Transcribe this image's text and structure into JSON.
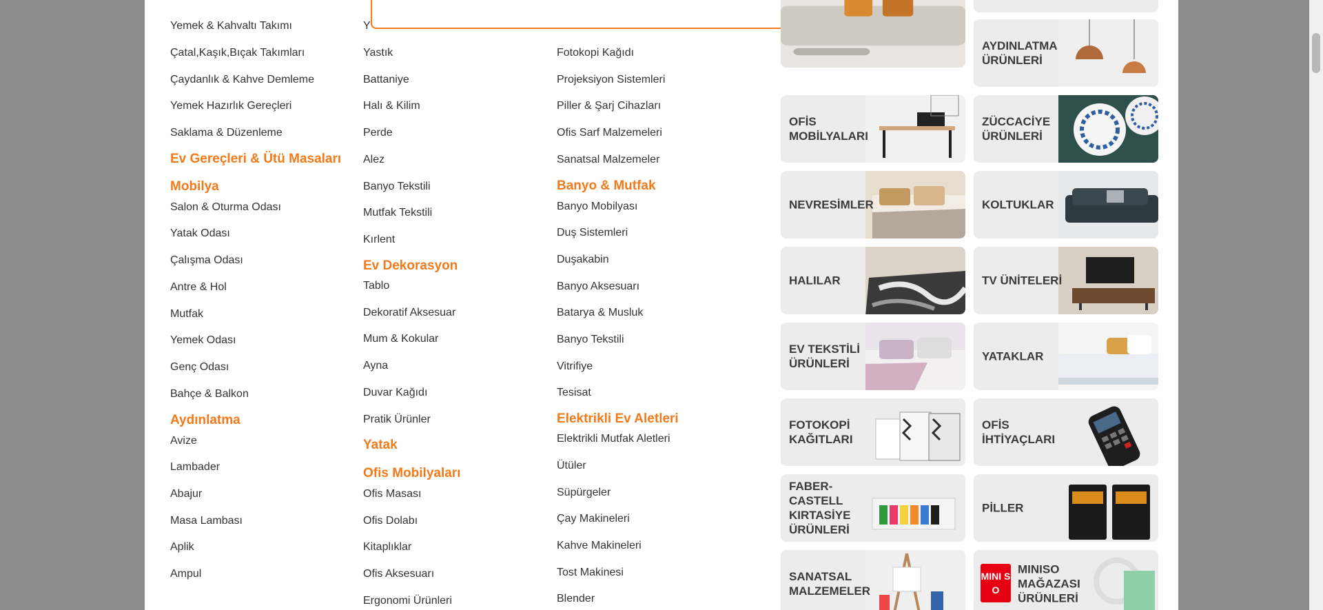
{
  "search_popup": {},
  "columns": [
    {
      "entries": [
        {
          "type": "item",
          "label": "Yemek & Kahvaltı Takımı"
        },
        {
          "type": "item",
          "label": "Çatal,Kaşık,Bıçak Takımları"
        },
        {
          "type": "item",
          "label": "Çaydanlık & Kahve Demleme"
        },
        {
          "type": "item",
          "label": "Yemek Hazırlık Gereçleri"
        },
        {
          "type": "item",
          "label": "Saklama & Düzenleme"
        },
        {
          "type": "head",
          "label": "Ev Gereçleri & Ütü Masaları"
        },
        {
          "type": "head",
          "label": "Mobilya"
        },
        {
          "type": "item",
          "label": "Salon & Oturma Odası"
        },
        {
          "type": "item",
          "label": "Yatak Odası"
        },
        {
          "type": "item",
          "label": "Çalışma Odası"
        },
        {
          "type": "item",
          "label": "Antre & Hol"
        },
        {
          "type": "item",
          "label": "Mutfak"
        },
        {
          "type": "item",
          "label": "Yemek Odası"
        },
        {
          "type": "item",
          "label": "Genç Odası"
        },
        {
          "type": "item",
          "label": "Bahçe & Balkon"
        },
        {
          "type": "head",
          "label": "Aydınlatma"
        },
        {
          "type": "item",
          "label": "Avize"
        },
        {
          "type": "item",
          "label": "Lambader"
        },
        {
          "type": "item",
          "label": "Abajur"
        },
        {
          "type": "item",
          "label": "Masa Lambası"
        },
        {
          "type": "item",
          "label": "Aplik"
        },
        {
          "type": "item",
          "label": "Ampul"
        }
      ]
    },
    {
      "entries": [
        {
          "type": "item",
          "label": "Y"
        },
        {
          "type": "item",
          "label": "Yastık"
        },
        {
          "type": "item",
          "label": "Battaniye"
        },
        {
          "type": "item",
          "label": "Halı & Kilim"
        },
        {
          "type": "item",
          "label": "Perde"
        },
        {
          "type": "item",
          "label": "Alez"
        },
        {
          "type": "item",
          "label": "Banyo Tekstili"
        },
        {
          "type": "item",
          "label": "Mutfak Tekstili"
        },
        {
          "type": "item",
          "label": "Kırlent"
        },
        {
          "type": "head",
          "label": "Ev Dekorasyon"
        },
        {
          "type": "item",
          "label": "Tablo"
        },
        {
          "type": "item",
          "label": "Dekoratif Aksesuar"
        },
        {
          "type": "item",
          "label": "Mum & Kokular"
        },
        {
          "type": "item",
          "label": "Ayna"
        },
        {
          "type": "item",
          "label": "Duvar Kağıdı"
        },
        {
          "type": "item",
          "label": "Pratik Ürünler"
        },
        {
          "type": "head",
          "label": "Yatak"
        },
        {
          "type": "head",
          "label": "Ofis Mobilyaları"
        },
        {
          "type": "item",
          "label": "Ofis Masası"
        },
        {
          "type": "item",
          "label": "Ofis Dolabı"
        },
        {
          "type": "item",
          "label": "Kitaplıklar"
        },
        {
          "type": "item",
          "label": "Ofis Aksesuarı"
        },
        {
          "type": "item",
          "label": "Ergonomi Ürünleri"
        }
      ]
    },
    {
      "entries": [
        {
          "type": "item",
          "label": "Fotokopi Kağıdı"
        },
        {
          "type": "item",
          "label": "Projeksiyon Sistemleri"
        },
        {
          "type": "item",
          "label": "Piller & Şarj Cihazları"
        },
        {
          "type": "item",
          "label": "Ofis Sarf Malzemeleri"
        },
        {
          "type": "item",
          "label": "Sanatsal Malzemeler"
        },
        {
          "type": "head",
          "label": "Banyo & Mutfak"
        },
        {
          "type": "item",
          "label": "Banyo Mobilyası"
        },
        {
          "type": "item",
          "label": "Duş Sistemleri"
        },
        {
          "type": "item",
          "label": "Duşakabin"
        },
        {
          "type": "item",
          "label": "Banyo Aksesuarı"
        },
        {
          "type": "item",
          "label": "Batarya & Musluk"
        },
        {
          "type": "item",
          "label": "Banyo Tekstili"
        },
        {
          "type": "item",
          "label": "Vitrifiye"
        },
        {
          "type": "item",
          "label": "Tesisat"
        },
        {
          "type": "head",
          "label": "Elektrikli Ev Aletleri"
        },
        {
          "type": "item",
          "label": "Elektrikli Mutfak Aletleri"
        },
        {
          "type": "item",
          "label": "Ütüler"
        },
        {
          "type": "item",
          "label": "Süpürgeler"
        },
        {
          "type": "item",
          "label": "Çay Makineleri"
        },
        {
          "type": "item",
          "label": "Kahve Makineleri"
        },
        {
          "type": "item",
          "label": "Tost Makinesi"
        },
        {
          "type": "item",
          "label": "Blender"
        }
      ]
    }
  ],
  "tiles": [
    {
      "label": "",
      "icon": "sofa-image"
    },
    {
      "label": "",
      "icon": "shelf-image"
    },
    {
      "label": "AYDINLATMA\nÜRÜNLERİ",
      "icon": "pendant-lamp-image"
    },
    {
      "label": "OFİS\nMOBİLYALARI",
      "icon": "office-desk-image"
    },
    {
      "label": "ZÜCCACİYE\nÜRÜNLERİ",
      "icon": "plates-image"
    },
    {
      "label": "NEVRESİMLER",
      "icon": "bedding-image"
    },
    {
      "label": "KOLTUKLAR",
      "icon": "armchair-image"
    },
    {
      "label": "HALILAR",
      "icon": "rug-image"
    },
    {
      "label": "TV ÜNİTELERİ",
      "icon": "tv-unit-image"
    },
    {
      "label": "EV TEKSTİLİ\nÜRÜNLERİ",
      "icon": "home-textile-image"
    },
    {
      "label": "YATAKLAR",
      "icon": "mattress-image"
    },
    {
      "label": "FOTOKOPİ\nKAĞITLARI",
      "icon": "copy-paper-image"
    },
    {
      "label": "OFİS\nİHTİYAÇLARI",
      "icon": "pos-terminal-image"
    },
    {
      "label": "FABER-CASTELL\nKIRTASİYE\nÜRÜNLERİ",
      "icon": "highlighters-image"
    },
    {
      "label": "PİLLER",
      "icon": "batteries-image"
    },
    {
      "label": "SANATSAL\nMALZEMELER",
      "icon": "easel-image"
    },
    {
      "label": "MINISO\nMAĞAZASI\nÜRÜNLERİ",
      "icon": "miniso-image",
      "logo_text": "MINI SO"
    }
  ],
  "colors": {
    "accent": "#f27a1a",
    "text": "#333333",
    "tile_bg": "#ececec",
    "overlay": "#8c8c8c"
  }
}
